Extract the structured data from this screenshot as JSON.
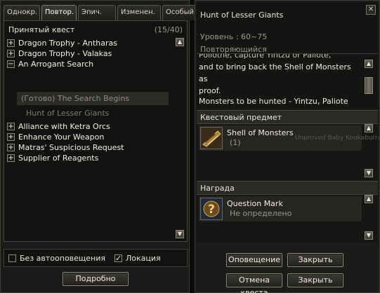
{
  "tabs": [
    "Однокр.",
    "Повтор.",
    "Эпич.",
    "Изменен.",
    "Особый"
  ],
  "list": {
    "header": "Принятый квест",
    "count": "(15/40)",
    "items_top": [
      {
        "sign": "+",
        "label": "Dragon Trophy - Antharas"
      },
      {
        "sign": "+",
        "label": "Dragon Trophy - Valakas"
      },
      {
        "sign": "−",
        "label": "An Arrogant Search"
      }
    ],
    "sub_done": "(Готово) The Search Begins",
    "sub_quest": "Hunt of Lesser Giants",
    "items_bottom": [
      {
        "sign": "+",
        "label": "Alliance with Ketra Orcs"
      },
      {
        "sign": "+",
        "label": "Enhance Your Weapon"
      },
      {
        "sign": "+",
        "label": "Matras' Suspicious Request"
      },
      {
        "sign": "+",
        "label": "Supplier of Reagents"
      }
    ]
  },
  "options": {
    "no_alert": "Без автооповещения",
    "no_alert_checked": false,
    "location": "Локация",
    "location_checked": true,
    "check_mark": "✓"
  },
  "details_button": "Подробно",
  "quest": {
    "title": "Hunt of Lesser Giants",
    "level": "Уровень : 60~75",
    "type": "Повторяющийся",
    "desc_partial": "Pollothe, capture Yintzu or Paliote,",
    "desc_lines": [
      "and to bring back the Shell of Monsters as",
      "proof."
    ],
    "targets": "Monsters to be hunted - Yintzu, Paliote"
  },
  "quest_item": {
    "section": "Квестовый предмет",
    "name": "Shell of Monsters",
    "qty": "(1)"
  },
  "reward": {
    "section": "Награда",
    "name": "Question Mark",
    "status": "Не определено"
  },
  "background_ghost": "Unproved Baby Kookaburra",
  "buttons": {
    "notify": "Оповещение",
    "close1": "Закрыть",
    "cancel": "Отмена квеста",
    "close2": "Закрыть"
  },
  "glyphs": {
    "up": "▲",
    "down": "▼",
    "close": "✕"
  },
  "colors": {
    "panel": "#1b1b19",
    "border": "#4a4843",
    "text": "#e8e4d8",
    "muted": "#9a978c"
  }
}
